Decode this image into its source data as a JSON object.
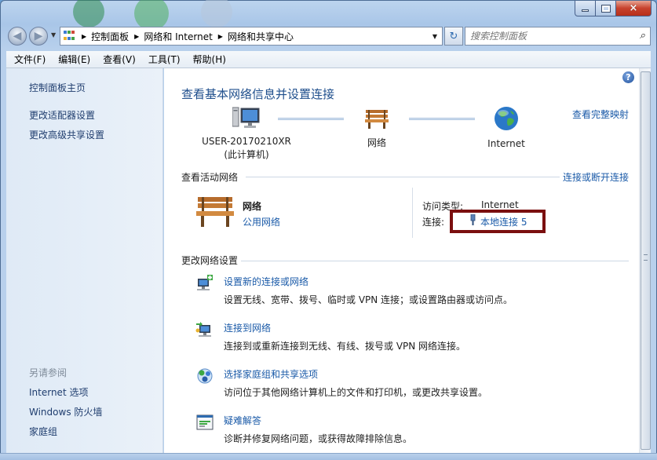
{
  "window": {
    "minimize": "minimize",
    "maximize": "maximize",
    "close": "×"
  },
  "address": {
    "crumbs": [
      "控制面板",
      "网络和 Internet",
      "网络和共享中心"
    ],
    "search_placeholder": "搜索控制面板"
  },
  "menu": [
    "文件(F)",
    "编辑(E)",
    "查看(V)",
    "工具(T)",
    "帮助(H)"
  ],
  "sidebar": {
    "items": [
      "控制面板主页",
      "更改适配器设置",
      "更改高级共享设置"
    ],
    "see_also_title": "另请参阅",
    "see_also": [
      "Internet 选项",
      "Windows 防火墙",
      "家庭组"
    ]
  },
  "main": {
    "title": "查看基本网络信息并设置连接",
    "map_link": "查看完整映射",
    "nodes": {
      "computer_name": "USER-20170210XR",
      "computer_sub": "(此计算机)",
      "network": "网络",
      "internet": "Internet"
    },
    "active": {
      "label": "查看活动网络",
      "toggle_link": "连接或断开连接",
      "network_name": "网络",
      "network_type": "公用网络",
      "access_label": "访问类型:",
      "access_value": "Internet",
      "connection_label": "连接:",
      "connection_value": "本地连接 5"
    },
    "change": {
      "label": "更改网络设置",
      "tasks": [
        {
          "title": "设置新的连接或网络",
          "desc": "设置无线、宽带、拨号、临时或 VPN 连接；或设置路由器或访问点。"
        },
        {
          "title": "连接到网络",
          "desc": "连接到或重新连接到无线、有线、拨号或 VPN 网络连接。"
        },
        {
          "title": "选择家庭组和共享选项",
          "desc": "访问位于其他网络计算机上的文件和打印机，或更改共享设置。"
        },
        {
          "title": "疑难解答",
          "desc": "诊断并修复网络问题，或获得故障排除信息。"
        }
      ]
    }
  },
  "colors": {
    "link": "#1a5aa8",
    "title": "#1e4e8c",
    "highlight": "#7b0f0f"
  }
}
